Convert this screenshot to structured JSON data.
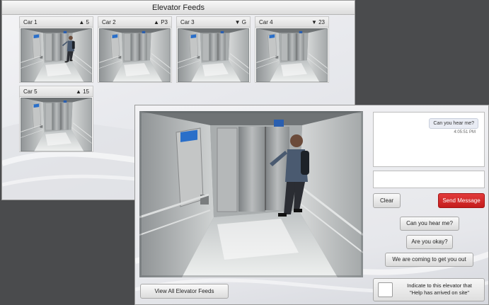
{
  "feeds_window": {
    "title": "Elevator Feeds",
    "cars": [
      {
        "name": "Car 1",
        "direction": "up",
        "arrow": "▲",
        "floor": "5",
        "occupied": true
      },
      {
        "name": "Car 2",
        "direction": "up",
        "arrow": "▲",
        "floor": "P3",
        "occupied": false
      },
      {
        "name": "Car 3",
        "direction": "down",
        "arrow": "▼",
        "floor": "G",
        "occupied": false
      },
      {
        "name": "Car 4",
        "direction": "down",
        "arrow": "▼",
        "floor": "23",
        "occupied": false
      },
      {
        "name": "Car 5",
        "direction": "up",
        "arrow": "▲",
        "floor": "15",
        "occupied": false
      }
    ]
  },
  "detail_window": {
    "view_all_label": "View All Elevator Feeds",
    "chat": {
      "messages": [
        {
          "text": "Can you hear me?",
          "time": "4:05:51 PM",
          "sender": "operator"
        }
      ]
    },
    "message_input": {
      "value": "",
      "placeholder": ""
    },
    "clear_label": "Clear",
    "send_label": "Send Message",
    "quick_replies": [
      "Can you hear me?",
      "Are you okay?",
      "We are coming to get you out"
    ],
    "indicate": {
      "line1": "Indicate to this elevator that",
      "line2": "\"Help has arrived on site\"",
      "checked": false
    }
  },
  "colors": {
    "desktop": "#4a4b4d",
    "send_button": "#d32a2a",
    "window_bg": "#ebecef"
  }
}
